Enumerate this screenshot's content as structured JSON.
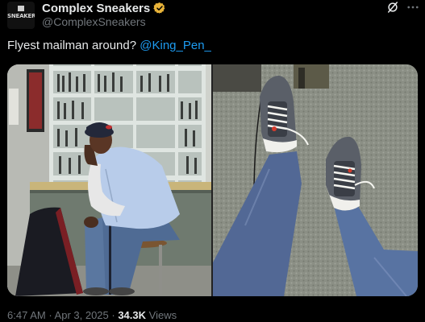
{
  "author": {
    "avatar_text": "SNEAKERS",
    "display_name": "Complex Sneakers",
    "handle": "@ComplexSneakers",
    "verified_color": "#e8b339"
  },
  "tweet": {
    "text": "Flyest mailman around? ",
    "mention": "@King_Pen_",
    "mention_color": "#1d9bf0"
  },
  "media": {
    "photos": [
      {
        "icon": "photo-man-seated-mailroom"
      },
      {
        "icon": "photo-sneakers-carpet"
      }
    ]
  },
  "meta": {
    "time": "6:47 AM",
    "sep1": " · ",
    "date": "Apr 3, 2025",
    "sep2": " · ",
    "views_count": "34.3K",
    "views_label": " Views"
  },
  "icons": {
    "grok": "grok-icon",
    "more": "more-icon",
    "verified": "verified-badge-icon"
  }
}
